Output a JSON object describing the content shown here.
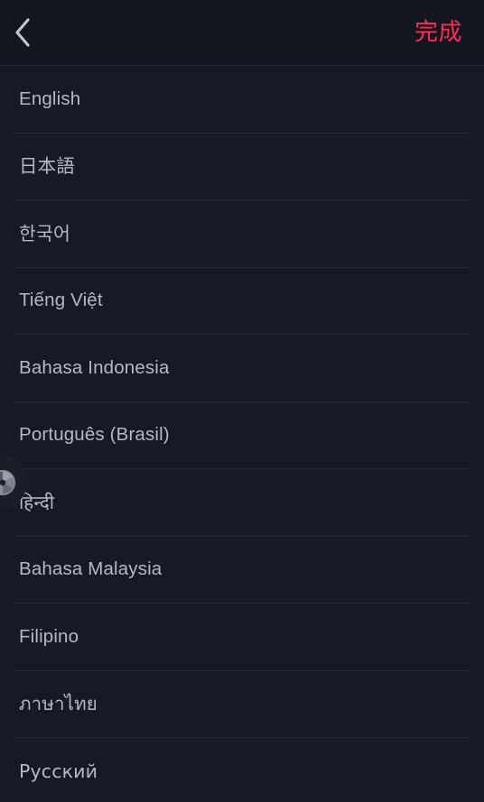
{
  "app": {
    "background_color": "#171a24",
    "accent_color": "#fe2c55",
    "text_color": "#b5b9c3",
    "divider_color": "#272b37"
  },
  "header": {
    "back_icon": "chevron-left-icon",
    "back_label": "",
    "done_label": "完成"
  },
  "language_list": {
    "items": [
      {
        "label": "English",
        "script": "latin"
      },
      {
        "label": "日本語",
        "script": "cjk"
      },
      {
        "label": "한국어",
        "script": "cjk"
      },
      {
        "label": "Tiếng Việt",
        "script": "latin"
      },
      {
        "label": "Bahasa Indonesia",
        "script": "latin"
      },
      {
        "label": "Português (Brasil)",
        "script": "latin"
      },
      {
        "label": "हिन्दी",
        "script": "devanagari"
      },
      {
        "label": "Bahasa Malaysia",
        "script": "latin"
      },
      {
        "label": "Filipino",
        "script": "latin"
      },
      {
        "label": "ภาษาไทย",
        "script": "thai"
      },
      {
        "label": "Русский",
        "script": "cyrillic"
      }
    ]
  },
  "floating_button": {
    "icon": "aperture-icon",
    "label": ""
  }
}
